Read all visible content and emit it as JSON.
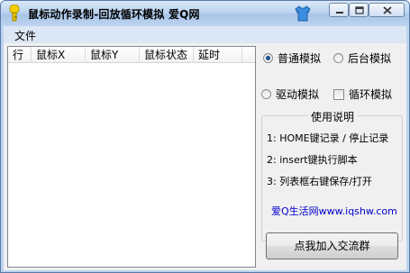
{
  "window": {
    "title": "鼠标动作录制-回放循环模拟 爱Q网"
  },
  "menu": {
    "file": "文件"
  },
  "list": {
    "columns": [
      "行",
      "鼠标X",
      "鼠标Y",
      "鼠标状态",
      "延时"
    ]
  },
  "options": {
    "normal_sim": "普通模拟",
    "background_sim": "后台模拟",
    "driver_sim": "驱动模拟",
    "loop_sim": "循环模拟",
    "selected": "普通模拟"
  },
  "help": {
    "title": "使用说明",
    "line1": "1: HOME键记录 / 停止记录",
    "line2": "2: insert键执行脚本",
    "line3": "3: 列表框右键保存/打开",
    "link": "爱Q生活网www.iqshw.com"
  },
  "button": {
    "join_group": "点我加入交流群"
  }
}
